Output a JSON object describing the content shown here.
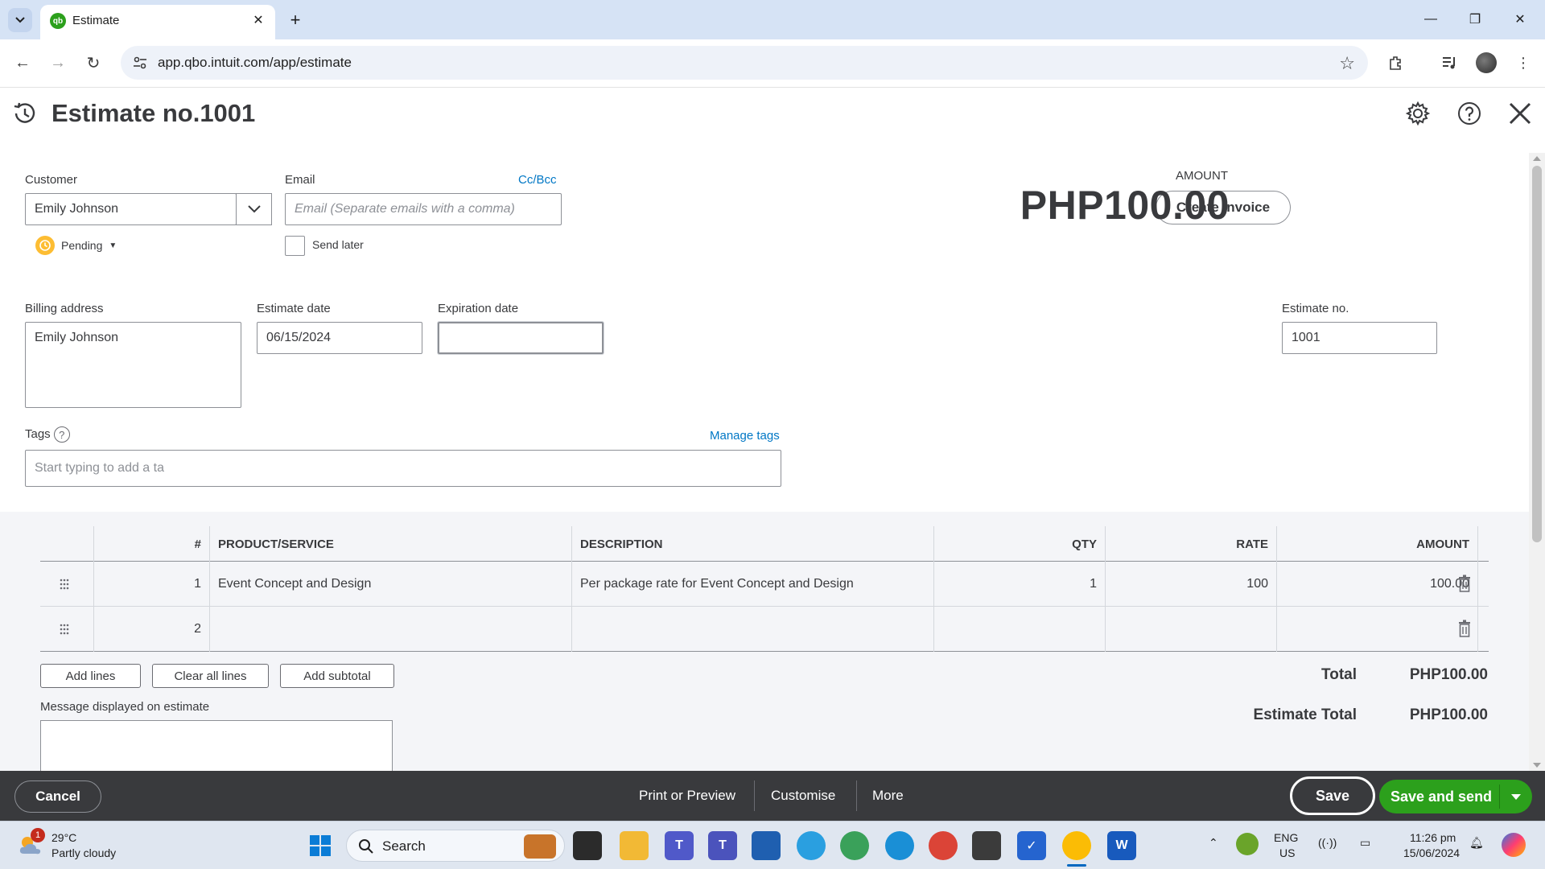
{
  "browser": {
    "tab_title": "Estimate",
    "tab_favicon": "qb",
    "url": "app.qbo.intuit.com/app/estimate"
  },
  "header": {
    "title": "Estimate no.1001"
  },
  "form": {
    "customer_label": "Customer",
    "customer_value": "Emily Johnson",
    "email_label": "Email",
    "email_placeholder": "Email (Separate emails with a comma)",
    "cc_bcc": "Cc/Bcc",
    "status": "Pending",
    "send_later": "Send later",
    "send_later_checked": false,
    "amount_label": "AMOUNT",
    "amount_value": "PHP100.00",
    "create_invoice": "Create invoice",
    "billing_address_label": "Billing address",
    "billing_address_value": "Emily Johnson",
    "estimate_date_label": "Estimate date",
    "estimate_date_value": "06/15/2024",
    "expiration_date_label": "Expiration date",
    "expiration_date_value": "",
    "estimate_no_label": "Estimate no.",
    "estimate_no_value": "1001",
    "tags_label": "Tags",
    "tags_placeholder": "Start typing to add a ta",
    "manage_tags": "Manage tags"
  },
  "table": {
    "headers": {
      "num": "#",
      "product": "PRODUCT/SERVICE",
      "description": "DESCRIPTION",
      "qty": "QTY",
      "rate": "RATE",
      "amount": "AMOUNT"
    },
    "rows": [
      {
        "num": "1",
        "product": "Event Concept and Design",
        "description": "Per package rate for Event Concept and Design",
        "qty": "1",
        "rate": "100",
        "amount": "100.00"
      },
      {
        "num": "2",
        "product": "",
        "description": "",
        "qty": "",
        "rate": "",
        "amount": ""
      }
    ]
  },
  "actions": {
    "add_lines": "Add lines",
    "clear_all_lines": "Clear all lines",
    "add_subtotal": "Add subtotal"
  },
  "totals": {
    "total_label": "Total",
    "total_value": "PHP100.00",
    "estimate_total_label": "Estimate Total",
    "estimate_total_value": "PHP100.00"
  },
  "message_label": "Message displayed on estimate",
  "footer": {
    "cancel": "Cancel",
    "print_preview": "Print or Preview",
    "customise": "Customise",
    "more": "More",
    "save": "Save",
    "save_and_send": "Save and send"
  },
  "taskbar": {
    "weather_badge": "1",
    "weather_temp": "29°C",
    "weather_desc": "Partly cloudy",
    "search": "Search",
    "lang_1": "ENG",
    "lang_2": "US",
    "time": "11:26 pm",
    "date": "15/06/2024"
  },
  "colors": {
    "accent_green": "#2ca01c",
    "link_blue": "#0077c5",
    "footer_bg": "#393a3d",
    "status_yellow": "#fdbd33"
  }
}
